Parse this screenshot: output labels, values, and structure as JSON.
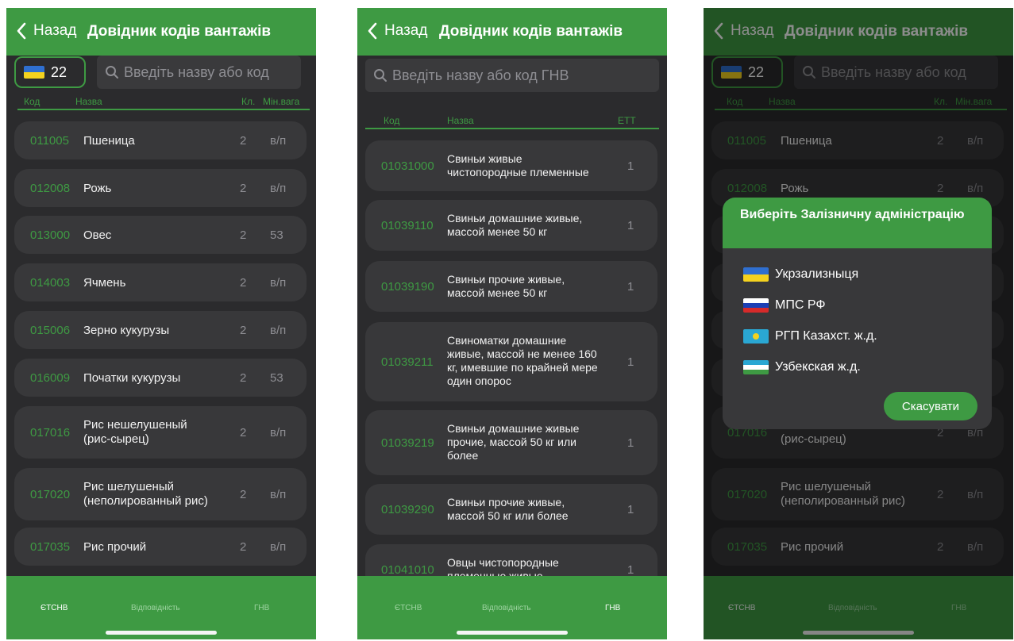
{
  "common": {
    "back_label": "Назад",
    "title": "Довідник кодів вантажів",
    "region_code": "22",
    "search_placeholder_short": "Введіть назву або код",
    "search_placeholder_gnv": "Введіть назву або код ГНВ",
    "col_code": "Код",
    "col_name": "Назва",
    "col_kl": "Кл.",
    "col_minweight": "Мін.вага",
    "col_ett": "ЕТТ",
    "tabs": [
      "ЄТСНВ",
      "Відповідність",
      "ГНВ"
    ]
  },
  "screen1": {
    "rows": [
      {
        "code": "011005",
        "name": "Пшеница",
        "kl": "2",
        "mv": "в/п"
      },
      {
        "code": "012008",
        "name": "Рожь",
        "kl": "2",
        "mv": "в/п"
      },
      {
        "code": "013000",
        "name": "Овес",
        "kl": "2",
        "mv": "53"
      },
      {
        "code": "014003",
        "name": "Ячмень",
        "kl": "2",
        "mv": "в/п"
      },
      {
        "code": "015006",
        "name": "Зерно кукурузы",
        "kl": "2",
        "mv": "в/п"
      },
      {
        "code": "016009",
        "name": "Початки кукурузы",
        "kl": "2",
        "mv": "53"
      },
      {
        "code": "017016",
        "name": "Рис нешелушеный",
        "name2": "(рис-сырец)",
        "kl": "2",
        "mv": "в/п"
      },
      {
        "code": "017020",
        "name": "Рис шелушеный",
        "name2": "(неполированный рис)",
        "kl": "2",
        "mv": "в/п"
      },
      {
        "code": "017035",
        "name": "Рис прочий",
        "kl": "2",
        "mv": "в/п"
      }
    ]
  },
  "screen2": {
    "rows": [
      {
        "code": "01031000",
        "lines": [
          "Свиньи живые",
          "чистопородные племенные"
        ],
        "ett": "1"
      },
      {
        "code": "01039110",
        "lines": [
          "Свиньи домашние живые,",
          "массой менее 50 кг"
        ],
        "ett": "1"
      },
      {
        "code": "01039190",
        "lines": [
          "Свиньи прочие живые,",
          "массой менее 50 кг"
        ],
        "ett": "1"
      },
      {
        "code": "01039211",
        "lines": [
          "Свиноматки домашние",
          "живые, массой не менее 160",
          "кг, имевшие по крайней мере",
          "один опорос"
        ],
        "ett": "1"
      },
      {
        "code": "01039219",
        "lines": [
          "Свиньи домашние живые",
          "прочие, массой 50 кг или",
          "более"
        ],
        "ett": "1"
      },
      {
        "code": "01039290",
        "lines": [
          "Свиньи прочие живые,",
          "массой 50 кг или более"
        ],
        "ett": "1"
      },
      {
        "code": "01041010",
        "lines": [
          "Овцы чистопородные",
          "племенные живые"
        ],
        "ett": "1"
      }
    ]
  },
  "screen3": {
    "dialog_title": "Виберіть Залізничну адміністрацію",
    "options": [
      "Укрзализныця",
      "МПС РФ",
      "РГП Казахст. ж.д.",
      "Узбекская ж.д."
    ],
    "cancel_label": "Скасувати"
  },
  "colors": {
    "accent": "#3e9a43",
    "background": "#2b2b2d",
    "row": "#38383a"
  }
}
